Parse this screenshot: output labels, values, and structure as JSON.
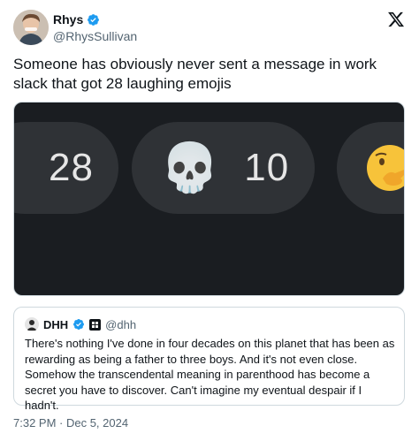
{
  "author": {
    "name": "Rhys",
    "handle": "@RhysSullivan"
  },
  "tweet": {
    "text": "Someone has obviously never sent a message in work slack that got 28 laughing emojis"
  },
  "media": {
    "reactions": [
      {
        "icon": "laughing-emoji-icon",
        "count": "28"
      },
      {
        "icon": "skull-emoji-icon",
        "emoji": "💀",
        "count": "10"
      },
      {
        "icon": "hand-over-mouth-emoji-icon",
        "count": ""
      }
    ]
  },
  "quote": {
    "name": "DHH",
    "handle": "@dhh",
    "text": "There's nothing I've done in four decades on this planet that has been as rewarding as being a father to three boys. And it's not even close. Somehow the transcendental meaning in parenthood has become a secret you have to discover. Can't imagine my eventual despair if I hadn't."
  },
  "timestamp": "7:32 PM · Dec 5, 2024",
  "colors": {
    "verified_blue": "#1d9bf0",
    "media_bg": "#1a1d21",
    "pill_bg": "#2f3236",
    "secondary_text": "#536471"
  }
}
